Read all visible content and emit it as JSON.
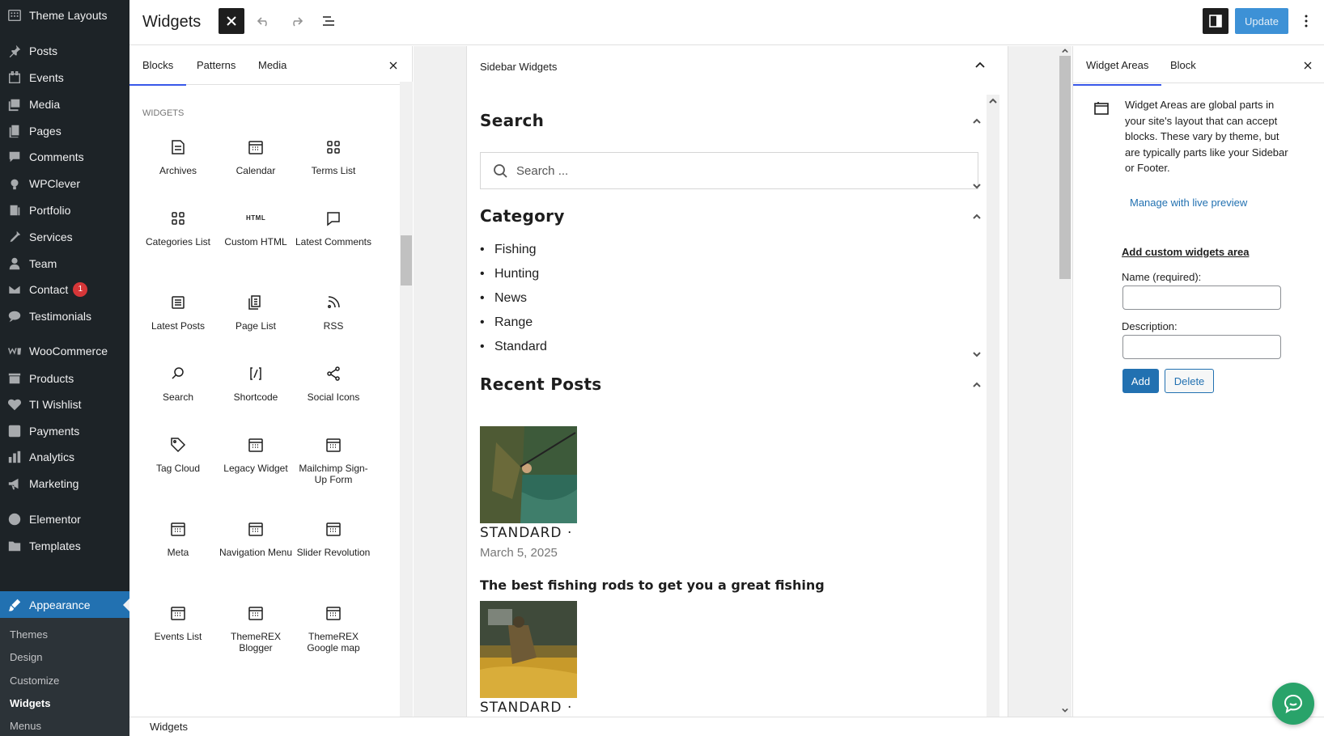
{
  "admin_menu": {
    "items": [
      {
        "label": "Theme Layouts",
        "icon": "layout-icon"
      },
      {
        "label": "Posts",
        "icon": "pin-icon"
      },
      {
        "label": "Events",
        "icon": "events-icon"
      },
      {
        "label": "Media",
        "icon": "media-icon"
      },
      {
        "label": "Pages",
        "icon": "pages-icon"
      },
      {
        "label": "Comments",
        "icon": "comment-icon"
      },
      {
        "label": "WPClever",
        "icon": "wpclever-icon"
      },
      {
        "label": "Portfolio",
        "icon": "portfolio-icon"
      },
      {
        "label": "Services",
        "icon": "services-icon"
      },
      {
        "label": "Team",
        "icon": "team-icon"
      },
      {
        "label": "Contact",
        "icon": "mail-icon",
        "badge": "1"
      },
      {
        "label": "Testimonials",
        "icon": "testimonials-icon"
      },
      {
        "label": "WooCommerce",
        "icon": "woocommerce-icon"
      },
      {
        "label": "Products",
        "icon": "products-icon"
      },
      {
        "label": "TI Wishlist",
        "icon": "heart-icon"
      },
      {
        "label": "Payments",
        "icon": "payments-icon"
      },
      {
        "label": "Analytics",
        "icon": "analytics-icon"
      },
      {
        "label": "Marketing",
        "icon": "megaphone-icon"
      },
      {
        "label": "Elementor",
        "icon": "elementor-icon"
      },
      {
        "label": "Templates",
        "icon": "folder-icon"
      },
      {
        "label": "Appearance",
        "icon": "brush-icon"
      }
    ],
    "submenu": [
      "Themes",
      "Design",
      "Customize",
      "Widgets",
      "Menus"
    ],
    "current_submenu": "Widgets"
  },
  "header": {
    "title": "Widgets",
    "update_label": "Update"
  },
  "inserter": {
    "tabs": [
      "Blocks",
      "Patterns",
      "Media"
    ],
    "section_heading": "WIDGETS",
    "blocks": [
      {
        "label": "Archives",
        "icon": "archive-icon"
      },
      {
        "label": "Calendar",
        "icon": "calendar-icon"
      },
      {
        "label": "Terms List",
        "icon": "grid-icon"
      },
      {
        "label": "Categories List",
        "icon": "grid-icon"
      },
      {
        "label": "Custom HTML",
        "icon": "html-icon"
      },
      {
        "label": "Latest Comments",
        "icon": "comment-icon"
      },
      {
        "label": "Latest Posts",
        "icon": "list-icon"
      },
      {
        "label": "Page List",
        "icon": "page-list-icon"
      },
      {
        "label": "RSS",
        "icon": "rss-icon"
      },
      {
        "label": "Search",
        "icon": "search-icon"
      },
      {
        "label": "Shortcode",
        "icon": "shortcode-icon"
      },
      {
        "label": "Social Icons",
        "icon": "share-icon"
      },
      {
        "label": "Tag Cloud",
        "icon": "tag-icon"
      },
      {
        "label": "Legacy Widget",
        "icon": "calendar-icon"
      },
      {
        "label": "Mailchimp Sign-Up Form",
        "icon": "calendar-icon"
      },
      {
        "label": "Meta",
        "icon": "calendar-icon"
      },
      {
        "label": "Navigation Menu",
        "icon": "calendar-icon"
      },
      {
        "label": "Slider Revolution",
        "icon": "calendar-icon"
      },
      {
        "label": "Events List",
        "icon": "calendar-icon"
      },
      {
        "label": "ThemeREX Blogger",
        "icon": "calendar-icon"
      },
      {
        "label": "ThemeREX Google map",
        "icon": "calendar-icon"
      }
    ],
    "html_icon_text": "HTML"
  },
  "canvas": {
    "area_title": "Sidebar Widgets",
    "search_title": "Search",
    "search_placeholder": "Search ...",
    "category_title": "Category",
    "categories": [
      "Fishing",
      "Hunting",
      "News",
      "Range",
      "Standard"
    ],
    "recent_title": "Recent Posts",
    "posts": [
      {
        "category": "STANDARD",
        "separator": "·",
        "date": "March 5, 2025",
        "title": "The best fishing rods to get you a great fishing"
      },
      {
        "category": "STANDARD",
        "separator": "·"
      }
    ]
  },
  "settings": {
    "tabs": [
      "Widget Areas",
      "Block"
    ],
    "description": "Widget Areas are global parts in your site's layout that can accept blocks. These vary by theme, but are typically parts like your Sidebar or Footer.",
    "manage_link": "Manage with live preview",
    "add_area_title": "Add custom widgets area",
    "name_label": "Name (required):",
    "description_label": "Description:",
    "add_label": "Add",
    "delete_label": "Delete"
  },
  "footer": {
    "breadcrumb": "Widgets"
  },
  "colors": {
    "admin_bg": "#1d2327",
    "accent": "#2271b1",
    "update_bg": "#3d91d6",
    "chat_green": "#29a36a"
  }
}
